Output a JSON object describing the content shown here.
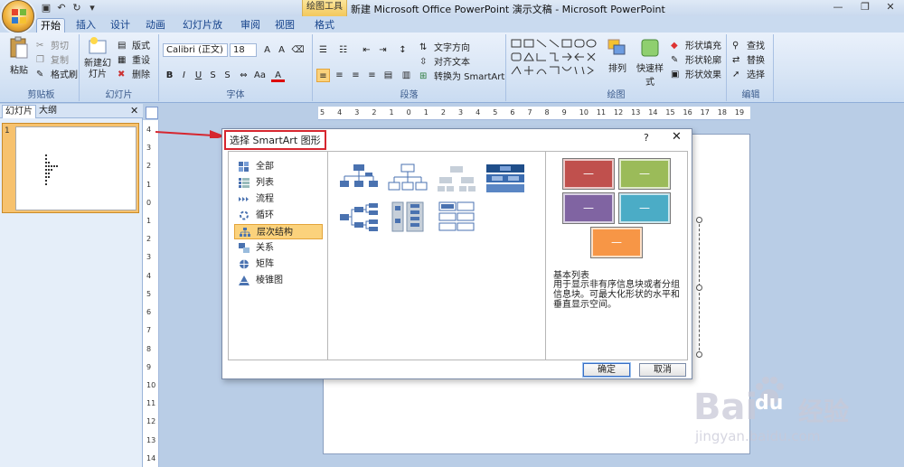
{
  "window": {
    "title": "新建 Microsoft Office PowerPoint 演示文稿 - Microsoft PowerPoint",
    "contextual_tab": "绘图工具"
  },
  "tabs": [
    "开始",
    "插入",
    "设计",
    "动画",
    "幻灯片放映",
    "审阅",
    "视图",
    "格式"
  ],
  "ribbon": {
    "clipboard": {
      "label": "剪贴板",
      "paste": "粘贴",
      "cut": "剪切",
      "copy": "复制",
      "format_painter": "格式刷"
    },
    "slides": {
      "label": "幻灯片",
      "new_slide": "新建幻灯片",
      "layout": "版式",
      "reset": "重设",
      "delete": "删除"
    },
    "font": {
      "label": "字体",
      "font_name": "Calibri (正文)",
      "font_size": "18"
    },
    "paragraph": {
      "label": "段落",
      "text_direction": "文字方向",
      "align_text": "对齐文本",
      "convert_smartart": "转换为 SmartArt"
    },
    "drawing": {
      "label": "绘图",
      "arrange": "排列",
      "quick_styles": "快速样式",
      "shape_fill": "形状填充",
      "shape_outline": "形状轮廓",
      "shape_effects": "形状效果"
    },
    "editing": {
      "label": "编辑",
      "find": "查找",
      "replace": "替换",
      "select": "选择"
    }
  },
  "left_panel": {
    "tab_slides": "幻灯片",
    "tab_outline": "大纲",
    "slide_number": "1"
  },
  "ruler": {
    "h_ticks": [
      "5",
      "4",
      "3",
      "2",
      "1",
      "0",
      "1",
      "2",
      "3",
      "4",
      "5",
      "6",
      "7",
      "8",
      "9",
      "10",
      "11",
      "12",
      "13",
      "14",
      "15",
      "16",
      "17",
      "18",
      "19"
    ],
    "v_ticks": [
      "4",
      "3",
      "2",
      "1",
      "0",
      "1",
      "2",
      "3",
      "4",
      "5",
      "6",
      "7",
      "8",
      "9",
      "10",
      "11",
      "12",
      "13",
      "14"
    ]
  },
  "dialog": {
    "title": "选择 SmartArt 图形",
    "help": "?",
    "close": "✕",
    "categories": [
      "全部",
      "列表",
      "流程",
      "循环",
      "层次结构",
      "关系",
      "矩阵",
      "棱锥图"
    ],
    "active_category": "层次结构",
    "preview": {
      "dash": "—",
      "title": "基本列表",
      "description": "用于显示非有序信息块或者分组信息块。可最大化形状的水平和垂直显示空间。",
      "colors": [
        "#c0504d",
        "#9bbb59",
        "#8064a2",
        "#4bacc6",
        "#f79646"
      ]
    },
    "ok": "确定",
    "cancel": "取消"
  },
  "watermark": {
    "brand": "Bai",
    "brand2": "du",
    "brand_cn": "经验",
    "url": "jingyan.baidu.com"
  }
}
